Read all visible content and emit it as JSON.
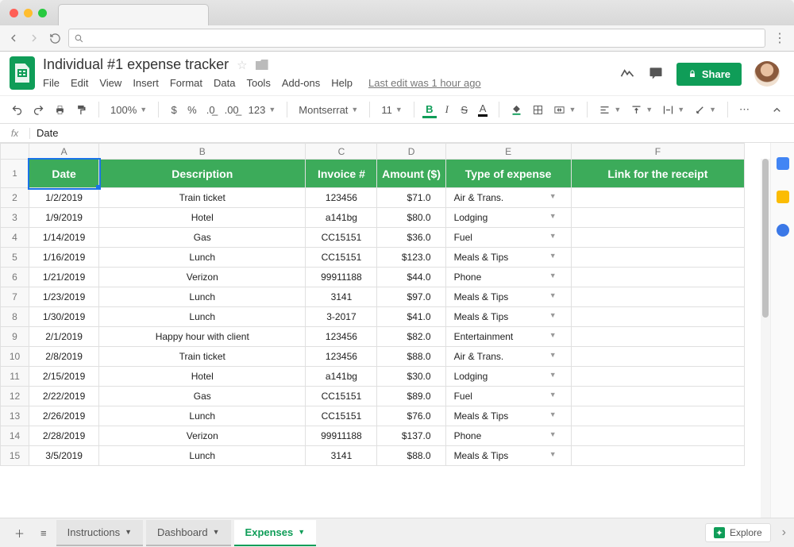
{
  "doc": {
    "title": "Individual #1 expense tracker",
    "last_edit": "Last edit was 1 hour ago"
  },
  "menu": {
    "file": "File",
    "edit": "Edit",
    "view": "View",
    "insert": "Insert",
    "format": "Format",
    "data": "Data",
    "tools": "Tools",
    "addons": "Add-ons",
    "help": "Help"
  },
  "toolbar": {
    "zoom": "100%",
    "font": "Montserrat",
    "font_size": "11",
    "num_fmt": "123"
  },
  "share": {
    "label": "Share"
  },
  "formula_bar": {
    "value": "Date"
  },
  "columns": {
    "A": "A",
    "B": "B",
    "C": "C",
    "D": "D",
    "E": "E",
    "F": "F"
  },
  "headers": {
    "date": "Date",
    "desc": "Description",
    "invoice": "Invoice #",
    "amount": "Amount ($)",
    "type": "Type of expense",
    "link": "Link for the receipt"
  },
  "rows": [
    {
      "n": "2",
      "date": "1/2/2019",
      "desc": "Train ticket",
      "inv": "123456",
      "amt": "$71.0",
      "type": "Air & Trans."
    },
    {
      "n": "3",
      "date": "1/9/2019",
      "desc": "Hotel",
      "inv": "a141bg",
      "amt": "$80.0",
      "type": "Lodging"
    },
    {
      "n": "4",
      "date": "1/14/2019",
      "desc": "Gas",
      "inv": "CC15151",
      "amt": "$36.0",
      "type": "Fuel"
    },
    {
      "n": "5",
      "date": "1/16/2019",
      "desc": "Lunch",
      "inv": "CC15151",
      "amt": "$123.0",
      "type": "Meals & Tips"
    },
    {
      "n": "6",
      "date": "1/21/2019",
      "desc": "Verizon",
      "inv": "99911188",
      "amt": "$44.0",
      "type": "Phone"
    },
    {
      "n": "7",
      "date": "1/23/2019",
      "desc": "Lunch",
      "inv": "3141",
      "amt": "$97.0",
      "type": "Meals & Tips"
    },
    {
      "n": "8",
      "date": "1/30/2019",
      "desc": "Lunch",
      "inv": "3-2017",
      "amt": "$41.0",
      "type": "Meals & Tips"
    },
    {
      "n": "9",
      "date": "2/1/2019",
      "desc": "Happy hour with client",
      "inv": "123456",
      "amt": "$82.0",
      "type": "Entertainment"
    },
    {
      "n": "10",
      "date": "2/8/2019",
      "desc": "Train ticket",
      "inv": "123456",
      "amt": "$88.0",
      "type": "Air & Trans."
    },
    {
      "n": "11",
      "date": "2/15/2019",
      "desc": "Hotel",
      "inv": "a141bg",
      "amt": "$30.0",
      "type": "Lodging"
    },
    {
      "n": "12",
      "date": "2/22/2019",
      "desc": "Gas",
      "inv": "CC15151",
      "amt": "$89.0",
      "type": "Fuel"
    },
    {
      "n": "13",
      "date": "2/26/2019",
      "desc": "Lunch",
      "inv": "CC15151",
      "amt": "$76.0",
      "type": "Meals & Tips"
    },
    {
      "n": "14",
      "date": "2/28/2019",
      "desc": "Verizon",
      "inv": "99911188",
      "amt": "$137.0",
      "type": "Phone"
    },
    {
      "n": "15",
      "date": "3/5/2019",
      "desc": "Lunch",
      "inv": "3141",
      "amt": "$88.0",
      "type": "Meals & Tips"
    }
  ],
  "tabs": {
    "instructions": "Instructions",
    "dashboard": "Dashboard",
    "expenses": "Expenses"
  },
  "explore": {
    "label": "Explore"
  }
}
